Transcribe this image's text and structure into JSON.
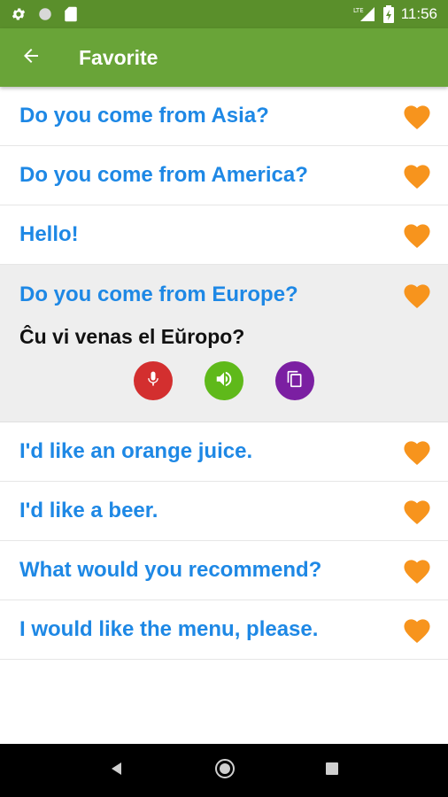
{
  "status_bar": {
    "time": "11:56",
    "network": "LTE"
  },
  "app_bar": {
    "title": "Favorite"
  },
  "colors": {
    "primary": "#69a438",
    "status": "#5a8f2b",
    "phrase": "#1e88e5",
    "heart": "#f7941d"
  },
  "favorites_top": [
    {
      "phrase": "Do you come from Asia?"
    },
    {
      "phrase": "Do you come from America?"
    },
    {
      "phrase": "Hello!"
    }
  ],
  "expanded": {
    "phrase": "Do you come from Europe?",
    "translation": "Ĉu vi venas el Eŭropo?"
  },
  "favorites_bottom": [
    {
      "phrase": "I'd like an orange juice."
    },
    {
      "phrase": "I'd like a beer."
    },
    {
      "phrase": "What would you recommend?"
    },
    {
      "phrase": "I would like the menu, please."
    }
  ]
}
